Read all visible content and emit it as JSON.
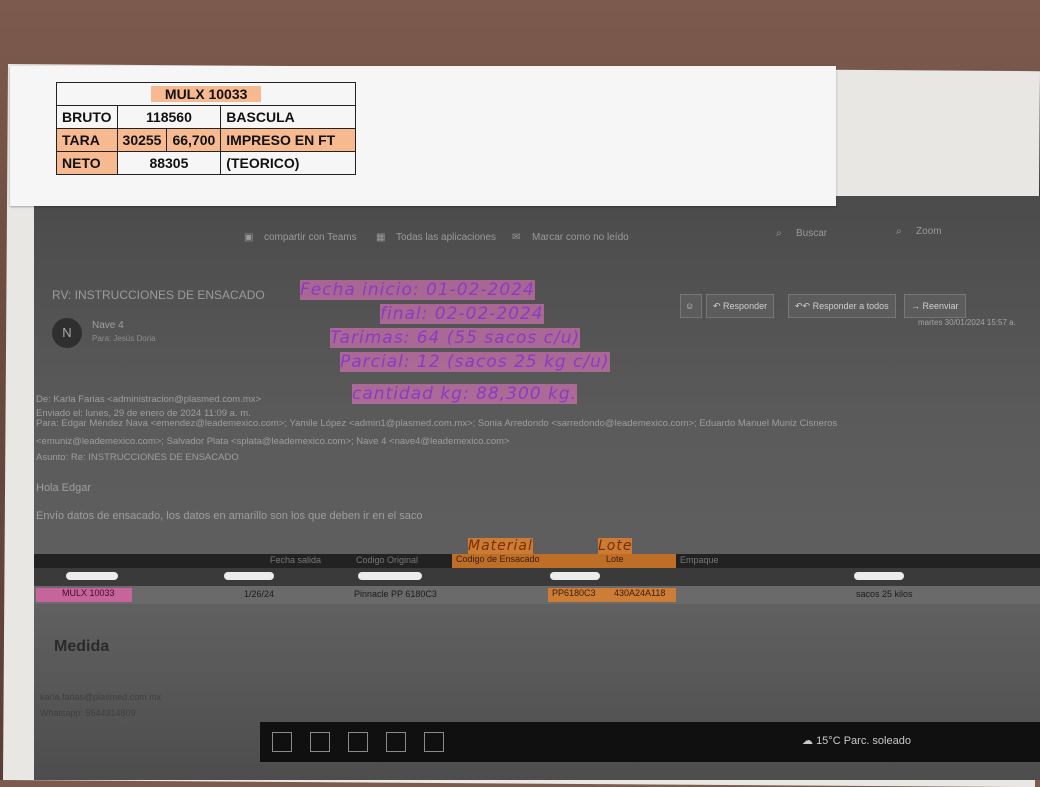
{
  "label_table": {
    "title": "MULX 10033",
    "rows": [
      {
        "label": "BRUTO",
        "v1": "118560",
        "v2": "",
        "note": "BASCULA"
      },
      {
        "label": "TARA",
        "v1": "30255",
        "v2": "66,700",
        "note": "IMPRESO EN FT"
      },
      {
        "label": "NETO",
        "v1": "88305",
        "v2": "",
        "note": "(TEORICO)"
      }
    ]
  },
  "email": {
    "ribbon": {
      "share": "compartir con Teams",
      "apps": "Todas las aplicaciones",
      "mark": "Marcar como no leído",
      "search": "Buscar",
      "zoom": "Zoom"
    },
    "subject": "RV: INSTRUCCIONES DE ENSACADO",
    "avatar_letter": "N",
    "sender": "Nave 4",
    "to_line": "Para: Jesús Doria",
    "actions": {
      "reply": "Responder",
      "reply_all": "Responder a todos",
      "forward": "Reenviar"
    },
    "date": "martes 30/01/2024 15:57 a.",
    "headers": [
      "De: Karla Farias <administracion@plasmed.com.mx>",
      "Enviado el: lunes, 29 de enero de 2024 11:09 a. m.",
      "Para: Edgar Méndez Nava <emendez@leademexico.com>; Yamile López <admin1@plasmed.com.mx>; Sonia Arredondo <sarredondo@leademexico.com>; Eduardo Manuel Muniz Cisneros",
      "<emuniz@leademexico.com>; Salvador Plata <splata@leademexico.com>; Nave 4 <nave4@leademexico.com>",
      "Asunto: Re: INSTRUCCIONES DE ENSACADO"
    ],
    "greeting": "Hola Edgar",
    "body": "Envío datos de ensacado, los datos en amarillo son los que deben ir en el saco",
    "table_headers": [
      "Fecha salida",
      "Codigo Original",
      "Codigo de Ensacado",
      "Lote",
      "Empaque"
    ],
    "table_row": {
      "pedido": "MULX 10033",
      "fecha": "1/26/24",
      "codigo_original": "Pinnacle PP 6180C3",
      "codigo_ensacado": "PP6180C3",
      "lote": "430A24A118",
      "empaque": "sacos 25 kilos"
    },
    "signature": {
      "company": "Medida",
      "email": "karla.farias@plasmed.com.mx",
      "phone": "Whatsapp: 5544314809"
    },
    "weather": "15°C  Parc. soleado"
  },
  "handwriting": {
    "fecha_inicio": "Fecha inicio: 01-02-2024",
    "fecha_final": "final: 02-02-2024",
    "tarimas": "Tarimas: 64 (55 sacos c/u)",
    "parcial": "Parcial: 12 (sacos 25 kg c/u)",
    "cantidad": "cantidad kg: 88,300 kg.",
    "material": "Material",
    "lote": "Lote"
  }
}
